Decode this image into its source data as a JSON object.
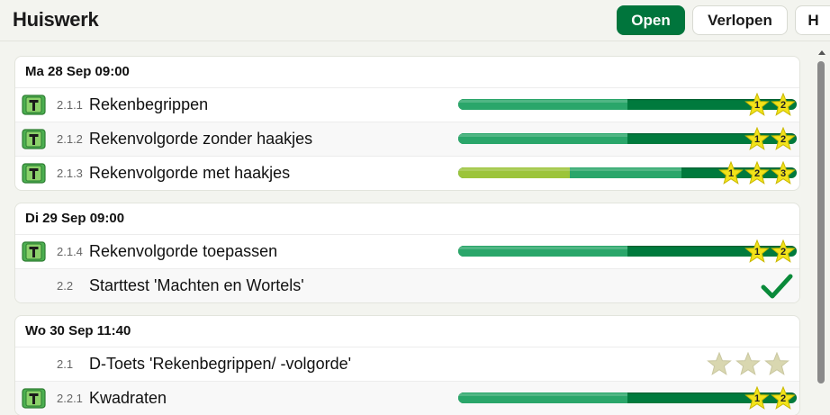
{
  "header": {
    "title": "Huiswerk",
    "tabs": [
      {
        "label": "Open",
        "active": true
      },
      {
        "label": "Verlopen",
        "active": false
      },
      {
        "label": "H",
        "active": false
      }
    ]
  },
  "colors": {
    "accent": "#00753c",
    "bar_dark": "#007a3d",
    "bar_mid": "#2aa66a",
    "bar_lime": "#9cc43a",
    "star_yellow": "#f2e31a",
    "star_empty": "#d9d7b0"
  },
  "groups": [
    {
      "date": "Ma 28 Sep 09:00",
      "items": [
        {
          "code": "2.1.1",
          "title": "Rekenbegrippen",
          "icon": "theory-book-icon",
          "progress": {
            "lime": 0,
            "mid": 0.5
          },
          "stars": [
            "1",
            "2"
          ]
        },
        {
          "code": "2.1.2",
          "title": "Rekenvolgorde zonder haakjes",
          "icon": "theory-book-icon",
          "progress": {
            "lime": 0,
            "mid": 0.5
          },
          "stars": [
            "1",
            "2"
          ]
        },
        {
          "code": "2.1.3",
          "title": "Rekenvolgorde met haakjes",
          "icon": "theory-book-icon",
          "progress": {
            "lime": 0.33,
            "mid": 0.33
          },
          "stars": [
            "1",
            "2",
            "3"
          ]
        }
      ]
    },
    {
      "date": "Di 29 Sep 09:00",
      "items": [
        {
          "code": "2.1.4",
          "title": "Rekenvolgorde toepassen",
          "icon": "theory-book-icon",
          "progress": {
            "lime": 0,
            "mid": 0.5
          },
          "stars": [
            "1",
            "2"
          ]
        },
        {
          "code": "2.2",
          "title": "Starttest 'Machten en Wortels'",
          "status": "completed-check-icon"
        }
      ]
    },
    {
      "date": "Wo 30 Sep 11:40",
      "items": [
        {
          "code": "2.1",
          "title": "D-Toets 'Rekenbegrippen/ -volgorde'",
          "status": "empty-stars",
          "empty_stars": 3
        },
        {
          "code": "2.2.1",
          "title": "Kwadraten",
          "icon": "theory-book-icon",
          "progress": {
            "lime": 0,
            "mid": 0.5
          },
          "stars": [
            "1",
            "2"
          ]
        }
      ]
    }
  ]
}
